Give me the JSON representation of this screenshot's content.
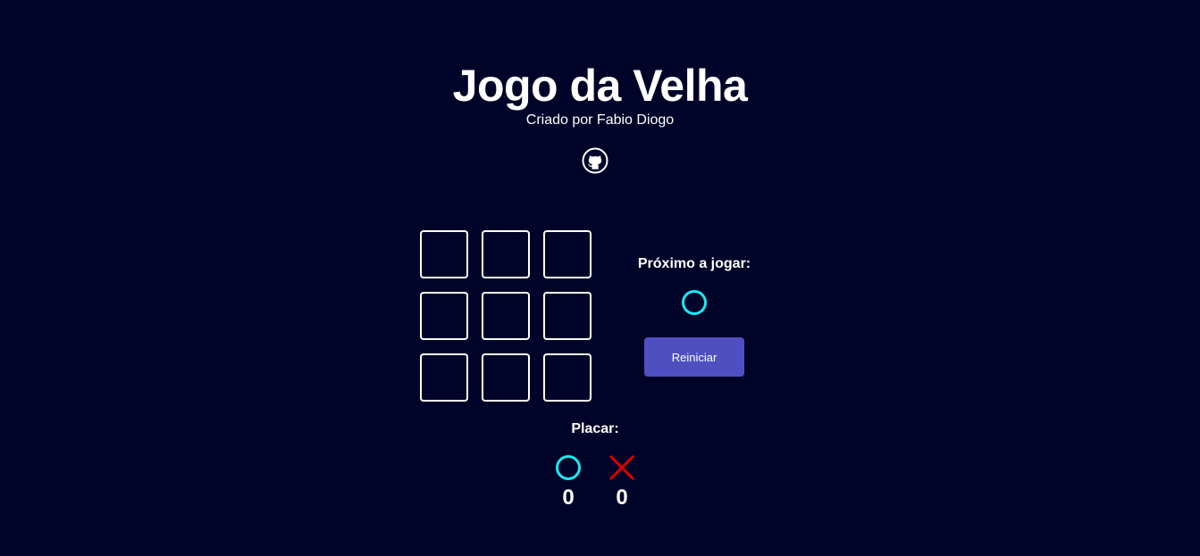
{
  "header": {
    "title": "Jogo da Velha",
    "subtitle": "Criado por Fabio Diogo",
    "github_icon": "github-icon"
  },
  "board": {
    "cells": [
      "",
      "",
      "",
      "",
      "",
      "",
      "",
      "",
      ""
    ]
  },
  "turn": {
    "label": "Próximo a jogar:",
    "current_player": "O",
    "icon": "circle-icon"
  },
  "controls": {
    "restart_label": "Reiniciar"
  },
  "score": {
    "label": "Placar:",
    "o": 0,
    "x": 0,
    "o_icon": "circle-icon",
    "x_icon": "cross-icon"
  },
  "colors": {
    "background": "#000428",
    "circle": "#1ee8f0",
    "cross": "#e00000",
    "button": "#4f4fc2",
    "cell_border": "#ffffff"
  }
}
